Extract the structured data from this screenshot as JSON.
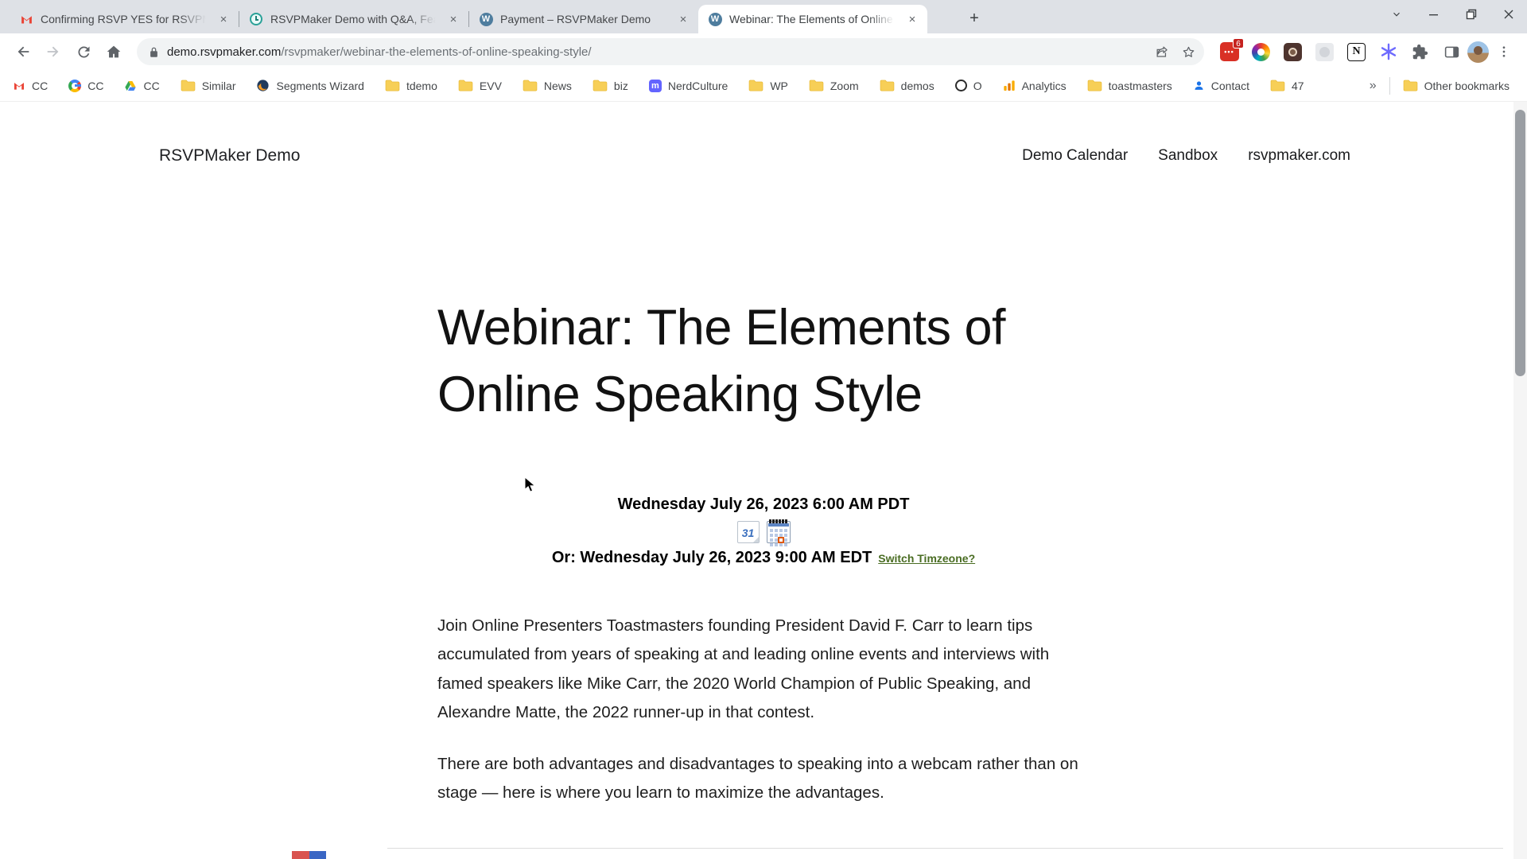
{
  "icons": {
    "close": "×",
    "new_tab": "+",
    "overflow": "»",
    "wordpress_w": "W",
    "notion_n": "N",
    "mastodon_m": "m",
    "gcal_day": "31",
    "ext_red_dots": "•••"
  },
  "browser": {
    "tabs": [
      {
        "title": "Confirming RSVP YES for RSVPMa",
        "favicon": "gmail"
      },
      {
        "title": "RSVPMaker Demo with Q&A, Fea",
        "favicon": "alarm-clock"
      },
      {
        "title": "Payment – RSVPMaker Demo",
        "favicon": "wordpress"
      },
      {
        "title": "Webinar: The Elements of Online",
        "favicon": "wordpress"
      }
    ],
    "toolbar": {
      "url_domain": "demo.rsvpmaker.com",
      "url_path": "/rsvpmaker/webinar-the-elements-of-online-speaking-style/",
      "extension_badge": "6"
    },
    "bookmarks": [
      {
        "label": "CC",
        "icon": "gmail"
      },
      {
        "label": "CC",
        "icon": "google"
      },
      {
        "label": "CC",
        "icon": "drive"
      },
      {
        "label": "Similar",
        "icon": "folder"
      },
      {
        "label": "Segments Wizard",
        "icon": "segments"
      },
      {
        "label": "tdemo",
        "icon": "folder"
      },
      {
        "label": "EVV",
        "icon": "folder"
      },
      {
        "label": "News",
        "icon": "folder"
      },
      {
        "label": "biz",
        "icon": "folder"
      },
      {
        "label": "NerdCulture",
        "icon": "mastodon"
      },
      {
        "label": "WP",
        "icon": "folder"
      },
      {
        "label": "Zoom",
        "icon": "folder"
      },
      {
        "label": "demos",
        "icon": "folder"
      },
      {
        "label": "O",
        "icon": "ring"
      },
      {
        "label": "Analytics",
        "icon": "analytics"
      },
      {
        "label": "toastmasters",
        "icon": "folder"
      },
      {
        "label": "Contact",
        "icon": "person"
      },
      {
        "label": "47",
        "icon": "folder"
      }
    ],
    "other_bookmarks": "Other bookmarks"
  },
  "page": {
    "site_title": "RSVPMaker Demo",
    "nav": [
      "Demo Calendar",
      "Sandbox",
      "rsvpmaker.com"
    ],
    "heading": "Webinar: The Elements of Online Speaking Style",
    "when_primary": "Wednesday July 26, 2023 6:00 AM PDT",
    "when_alt": "Or: Wednesday July 26, 2023 9:00 AM EDT",
    "switch_tz_link": "Switch Timzeone?",
    "paragraphs": {
      "p1": "Join Online Presenters Toastmasters founding President David F. Carr to learn tips accumulated from years of speaking at and leading online events and interviews with famed speakers like Mike Carr, the 2020 World Champion of Public Speaking, and Alexandre Matte, the 2022 runner-up in that contest.",
      "p2": "There are both advantages and disadvantages to speaking into a webcam rather than on stage — here is where you learn to maximize the advantages."
    }
  },
  "colors": {
    "tabbar_bg": "#dee1e6",
    "omnibox_bg": "#f1f3f4",
    "folder_yellow": "#f7cf57",
    "link_green": "#4a6d23",
    "wordpress_blue": "#4e7d9e",
    "badge_red": "#d93025",
    "analytics_orange": "#f9ab00"
  }
}
